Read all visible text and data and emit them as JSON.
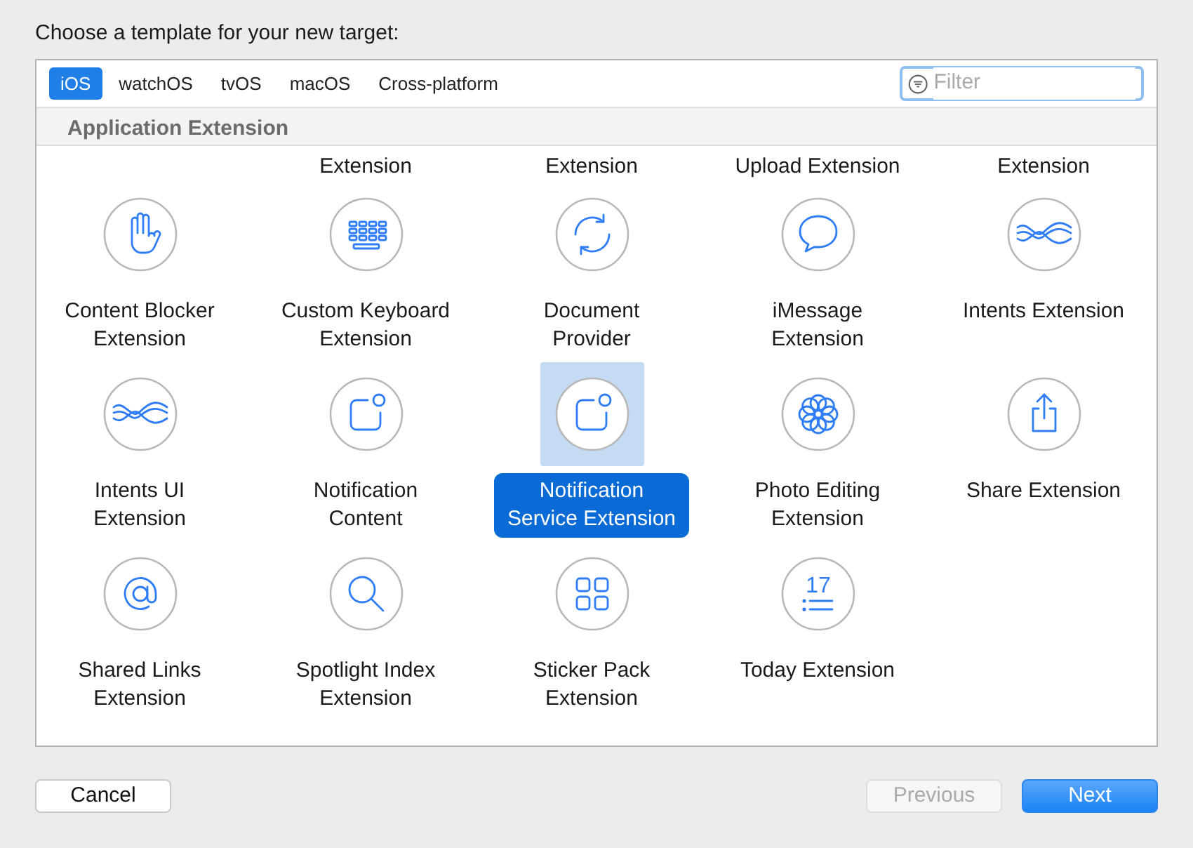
{
  "title": "Choose a template for your new target:",
  "tabs": [
    {
      "label": "iOS",
      "selected": true
    },
    {
      "label": "watchOS",
      "selected": false
    },
    {
      "label": "tvOS",
      "selected": false
    },
    {
      "label": "macOS",
      "selected": false
    },
    {
      "label": "Cross-platform",
      "selected": false
    }
  ],
  "filter": {
    "placeholder": "Filter"
  },
  "section": {
    "title": "Application Extension",
    "partial_row": [
      "Extension",
      "Extension",
      "Upload Extension",
      "Extension"
    ],
    "templates": [
      {
        "kind": "hand",
        "label": [
          "Content Blocker",
          "Extension"
        ],
        "selected": false
      },
      {
        "kind": "keyboard",
        "label": [
          "Custom Keyboard",
          "Extension"
        ],
        "selected": false
      },
      {
        "kind": "sync",
        "label": [
          "Document",
          "Provider"
        ],
        "selected": false
      },
      {
        "kind": "bubble",
        "label": [
          "iMessage",
          "Extension"
        ],
        "selected": false
      },
      {
        "kind": "waves",
        "label": [
          "Intents Extension"
        ],
        "selected": false
      },
      {
        "kind": "waves",
        "label": [
          "Intents UI",
          "Extension"
        ],
        "selected": false
      },
      {
        "kind": "notification",
        "label": [
          "Notification",
          "Content"
        ],
        "selected": false
      },
      {
        "kind": "notification",
        "label": [
          "Notification",
          "Service Extension"
        ],
        "selected": true
      },
      {
        "kind": "flower",
        "label": [
          "Photo Editing",
          "Extension"
        ],
        "selected": false
      },
      {
        "kind": "share",
        "label": [
          "Share Extension"
        ],
        "selected": false
      },
      {
        "kind": "at",
        "label": [
          "Shared Links",
          "Extension"
        ],
        "selected": false
      },
      {
        "kind": "search",
        "label": [
          "Spotlight Index",
          "Extension"
        ],
        "selected": false
      },
      {
        "kind": "grid",
        "label": [
          "Sticker Pack",
          "Extension"
        ],
        "selected": false
      },
      {
        "kind": "calendar",
        "icon_text": "17",
        "label": [
          "Today Extension"
        ],
        "selected": false
      }
    ]
  },
  "buttons": [
    {
      "label": "Cancel",
      "kind": "plain",
      "disabled": false
    },
    {
      "label": "Previous",
      "kind": "plain",
      "disabled": true
    },
    {
      "label": "Next",
      "kind": "default",
      "disabled": false
    }
  ]
}
